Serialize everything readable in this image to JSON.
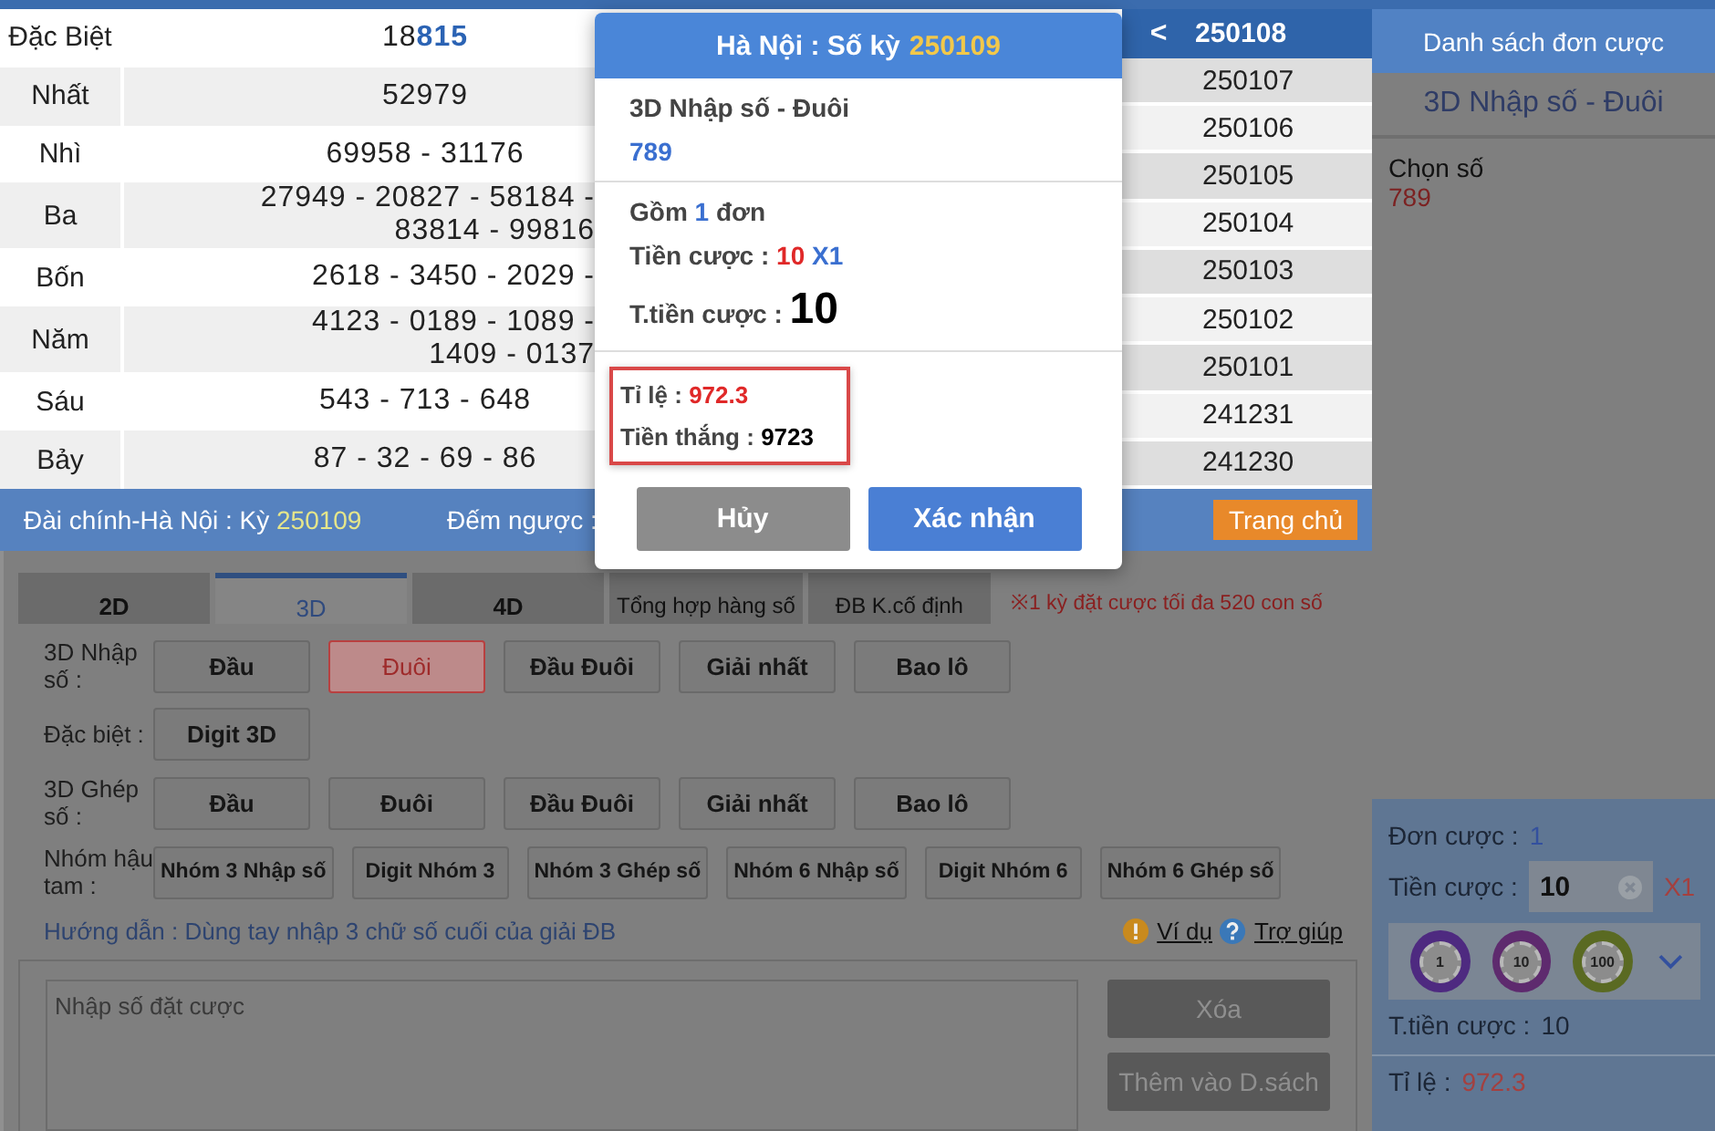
{
  "results": {
    "rows": [
      {
        "prize": "Đặc Biệt",
        "lines": [
          "18**815**"
        ],
        "cut": false
      },
      {
        "prize": "Nhất",
        "lines": [
          "52979"
        ],
        "cut": false
      },
      {
        "prize": "Nhì",
        "lines": [
          "69958 - 31176"
        ],
        "cut": false
      },
      {
        "prize": "Ba",
        "lines": [
          "27949 - 20827 - 58184 -",
          "83814 - 99816"
        ],
        "cut": true
      },
      {
        "prize": "Bốn",
        "lines": [
          "2618 - 3450 - 2029 -"
        ],
        "cut": true
      },
      {
        "prize": "Năm",
        "lines": [
          "4123 - 0189 - 1089 -",
          "1409 - 0137"
        ],
        "cut": true
      },
      {
        "prize": "Sáu",
        "lines": [
          "543 - 713 - 648"
        ],
        "cut": false
      },
      {
        "prize": "Bảy",
        "lines": [
          "87 - 32 - 69 - 86"
        ],
        "cut": false
      }
    ]
  },
  "periods": {
    "back": "<",
    "current": "250108",
    "items": [
      "250107",
      "250106",
      "250105",
      "250104",
      "250103",
      "250102",
      "250101",
      "241231",
      "241230"
    ]
  },
  "info_bar": {
    "station": "Đài chính-Hà Nội  :  Kỳ",
    "period": "250109",
    "countdown_label": "Đếm ngược :",
    "home_button": "Trang chủ"
  },
  "tabs": [
    {
      "label": "2D",
      "selected": false
    },
    {
      "label": "3D",
      "selected": true
    },
    {
      "label": "4D",
      "selected": false
    },
    {
      "label": "Tổng hợp hàng số",
      "selected": false
    },
    {
      "label": "ĐB K.cố định",
      "selected": false
    }
  ],
  "note": "※1 kỳ đặt cược tối đa 520 con số",
  "bet_rows": [
    {
      "label": "3D Nhập số :",
      "buttons": [
        {
          "label": "Đầu",
          "selected": false
        },
        {
          "label": "Đuôi",
          "selected": true
        },
        {
          "label": "Đầu Đuôi",
          "selected": false
        },
        {
          "label": "Giải nhất",
          "selected": false
        },
        {
          "label": "Bao lô",
          "selected": false
        }
      ]
    },
    {
      "label": "Đặc biệt :",
      "buttons": [
        {
          "label": "Digit 3D",
          "selected": false
        }
      ]
    },
    {
      "label": "3D Ghép số :",
      "buttons": [
        {
          "label": "Đầu",
          "selected": false
        },
        {
          "label": "Đuôi",
          "selected": false
        },
        {
          "label": "Đầu Đuôi",
          "selected": false
        },
        {
          "label": "Giải nhất",
          "selected": false
        },
        {
          "label": "Bao lô",
          "selected": false
        }
      ]
    },
    {
      "label": "Nhóm hậu tam :",
      "buttons": [
        {
          "label": "Nhóm 3 Nhập số",
          "selected": false
        },
        {
          "label": "Digit Nhóm 3",
          "selected": false
        },
        {
          "label": "Nhóm 3 Ghép số",
          "selected": false
        },
        {
          "label": "Nhóm 6 Nhập số",
          "selected": false
        },
        {
          "label": "Digit Nhóm 6",
          "selected": false
        },
        {
          "label": "Nhóm 6 Ghép số",
          "selected": false
        }
      ]
    }
  ],
  "guide": "Hướng dẫn : Dùng tay nhập 3 chữ số cuối của giải ĐB",
  "links": [
    {
      "label": "Ví dụ",
      "kind": "example"
    },
    {
      "label": "Trợ giúp",
      "kind": "help"
    }
  ],
  "entry": {
    "placeholder": "Nhập số đặt cược"
  },
  "entry_buttons": [
    "Xóa",
    "Thêm vào D.sách"
  ],
  "sidebar": {
    "title": "Danh sách đơn cược",
    "bet_type": "3D Nhập số - Đuôi",
    "pick_label": "Chọn số",
    "pick": "789",
    "count_label": "Đơn cược :",
    "count": "1",
    "stake_label": "Tiền cược :",
    "stake": "10",
    "multiplier": "X1",
    "chips": [
      {
        "value": "1",
        "color": "#4e2a80"
      },
      {
        "value": "10",
        "color": "#5e2a6e"
      },
      {
        "value": "100",
        "color": "#5a6a22"
      }
    ],
    "total_label": "T.tiền cược :",
    "total": "10",
    "odds_label": "Tỉ lệ :",
    "odds": "972.3"
  },
  "modal": {
    "title": "Hà Nội : Số kỳ",
    "period": "250109",
    "bet_type": "3D Nhập số - Đuôi",
    "numbers": "789",
    "count_prefix": "Gồm",
    "count": "1",
    "count_suffix": "đơn",
    "stake_label": "Tiền cược :",
    "stake": "10",
    "multiplier": "X1",
    "total_label": "T.tiền cược :",
    "total": "10",
    "odds_label": "Tỉ lệ  :",
    "odds": "972.3",
    "win_label": "Tiền thắng :",
    "win": "9723",
    "highlighted": true,
    "buttons": [
      {
        "label": "Hủy",
        "kind": "cancel"
      },
      {
        "label": "Xác nhận",
        "kind": "confirm"
      }
    ]
  }
}
